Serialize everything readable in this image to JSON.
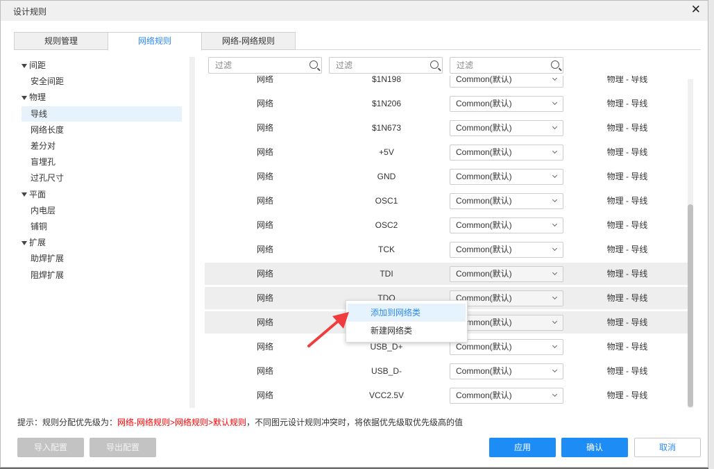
{
  "window": {
    "title": "设计规则",
    "close_icon": "close-icon"
  },
  "tabs": [
    {
      "label": "规则管理"
    },
    {
      "label": "网络规则",
      "active": true
    },
    {
      "label": "网络-网络规则"
    }
  ],
  "tree": [
    {
      "label": "间距",
      "group": true
    },
    {
      "label": "安全间距"
    },
    {
      "label": "物理",
      "group": true
    },
    {
      "label": "导线",
      "selected": true
    },
    {
      "label": "网络长度"
    },
    {
      "label": "差分对"
    },
    {
      "label": "盲埋孔"
    },
    {
      "label": "过孔尺寸"
    },
    {
      "label": "平面",
      "group": true
    },
    {
      "label": "内电层"
    },
    {
      "label": "铺铜"
    },
    {
      "label": "扩展",
      "group": true
    },
    {
      "label": "助焊扩展"
    },
    {
      "label": "阻焊扩展"
    }
  ],
  "filters": [
    {
      "placeholder": "过滤"
    },
    {
      "placeholder": "过滤"
    },
    {
      "placeholder": "过滤"
    }
  ],
  "rows": [
    {
      "type": "网络",
      "name": "$1N198",
      "rule": "Common(默认)",
      "category": "物理 - 导线"
    },
    {
      "type": "网络",
      "name": "$1N206",
      "rule": "Common(默认)",
      "category": "物理 - 导线"
    },
    {
      "type": "网络",
      "name": "$1N673",
      "rule": "Common(默认)",
      "category": "物理 - 导线"
    },
    {
      "type": "网络",
      "name": "+5V",
      "rule": "Common(默认)",
      "category": "物理 - 导线"
    },
    {
      "type": "网络",
      "name": "GND",
      "rule": "Common(默认)",
      "category": "物理 - 导线"
    },
    {
      "type": "网络",
      "name": "OSC1",
      "rule": "Common(默认)",
      "category": "物理 - 导线"
    },
    {
      "type": "网络",
      "name": "OSC2",
      "rule": "Common(默认)",
      "category": "物理 - 导线"
    },
    {
      "type": "网络",
      "name": "TCK",
      "rule": "Common(默认)",
      "category": "物理 - 导线"
    },
    {
      "type": "网络",
      "name": "TDI",
      "rule": "Common(默认)",
      "category": "物理 - 导线",
      "highlighted": true
    },
    {
      "type": "网络",
      "name": "TDO",
      "rule": "Common(默认)",
      "category": "物理 - 导线",
      "highlighted": true
    },
    {
      "type": "网络",
      "name": "",
      "rule": "Common(默认)",
      "category": "物理 - 导线",
      "highlighted": true
    },
    {
      "type": "网络",
      "name": "USB_D+",
      "rule": "Common(默认)",
      "category": "物理 - 导线"
    },
    {
      "type": "网络",
      "name": "USB_D-",
      "rule": "Common(默认)",
      "category": "物理 - 导线"
    },
    {
      "type": "网络",
      "name": "VCC2.5V",
      "rule": "Common(默认)",
      "category": "物理 - 导线"
    }
  ],
  "context_menu": [
    {
      "label": "添加到网络类",
      "hovered": true
    },
    {
      "label": "新建网络类"
    }
  ],
  "hint": {
    "prefix": "提示：规则分配优先级为：",
    "priority": "网络-网络规则>网络规则>默认规则",
    "suffix": "，不同图元设计规则冲突时，将依据优先级取优先级高的值"
  },
  "buttons": {
    "import": "导入配置",
    "export": "导出配置",
    "apply": "应用",
    "confirm": "确认",
    "cancel": "取消"
  },
  "colors": {
    "accent": "#1e8cf5",
    "warning_text": "#ff0000",
    "annotation_arrow": "#f03c3c"
  }
}
